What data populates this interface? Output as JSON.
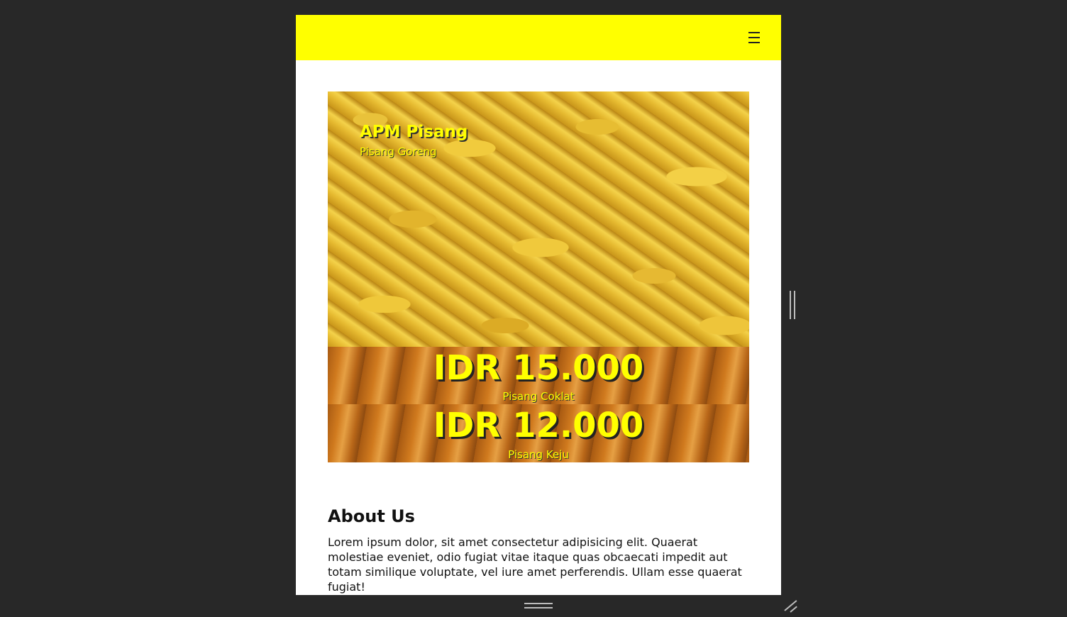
{
  "navbar": {
    "background": "#ffff00",
    "menu_icon": "hamburger-menu-icon"
  },
  "hero": {
    "title": "APM Pisang",
    "subtitle": "Pisang Goreng",
    "image": "bananas-photo",
    "accent": "#ffff00"
  },
  "prices": [
    {
      "amount": "IDR 15.000",
      "label": "Pisang Coklat"
    },
    {
      "amount": "IDR 12.000",
      "label": "Pisang Keju"
    }
  ],
  "about": {
    "heading": "About Us",
    "text": "Lorem ipsum dolor, sit amet consectetur adipisicing elit. Quaerat molestiae eveniet, odio fugiat vitae itaque quas obcaecati impedit aut totam similique voluptate, vel iure amet perferendis. Ullam esse quaerat fugiat!"
  },
  "device_frame": {
    "background": "#282828",
    "side_handle_icon": "resize-handle-vertical-icon",
    "bottom_handle_icon": "resize-handle-horizontal-icon",
    "corner_handle_icon": "resize-corner-icon"
  }
}
